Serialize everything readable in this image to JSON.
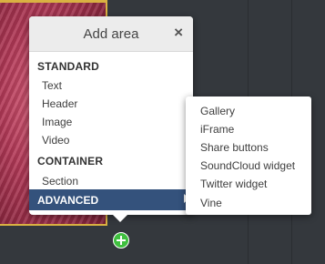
{
  "popup": {
    "title": "Add area",
    "close_icon": "×",
    "sections": [
      {
        "title": "STANDARD",
        "items": [
          "Text",
          "Header",
          "Image",
          "Video"
        ]
      },
      {
        "title": "CONTAINER",
        "items": [
          "Section"
        ]
      }
    ],
    "advanced": {
      "label": "ADVANCED",
      "selected": true
    }
  },
  "submenu": {
    "items": [
      "Gallery",
      "iFrame",
      "Share buttons",
      "SoundCloud widget",
      "Twitter widget",
      "Vine"
    ]
  },
  "colors": {
    "canvas_bg": "#34383d",
    "selected_row": "#34527c",
    "selection_border": "#d9b142",
    "add_button": "#3fbf3f"
  },
  "icons": {
    "close": "close-icon",
    "add": "add-icon",
    "submenu_arrow": "chevron-right-icon"
  }
}
